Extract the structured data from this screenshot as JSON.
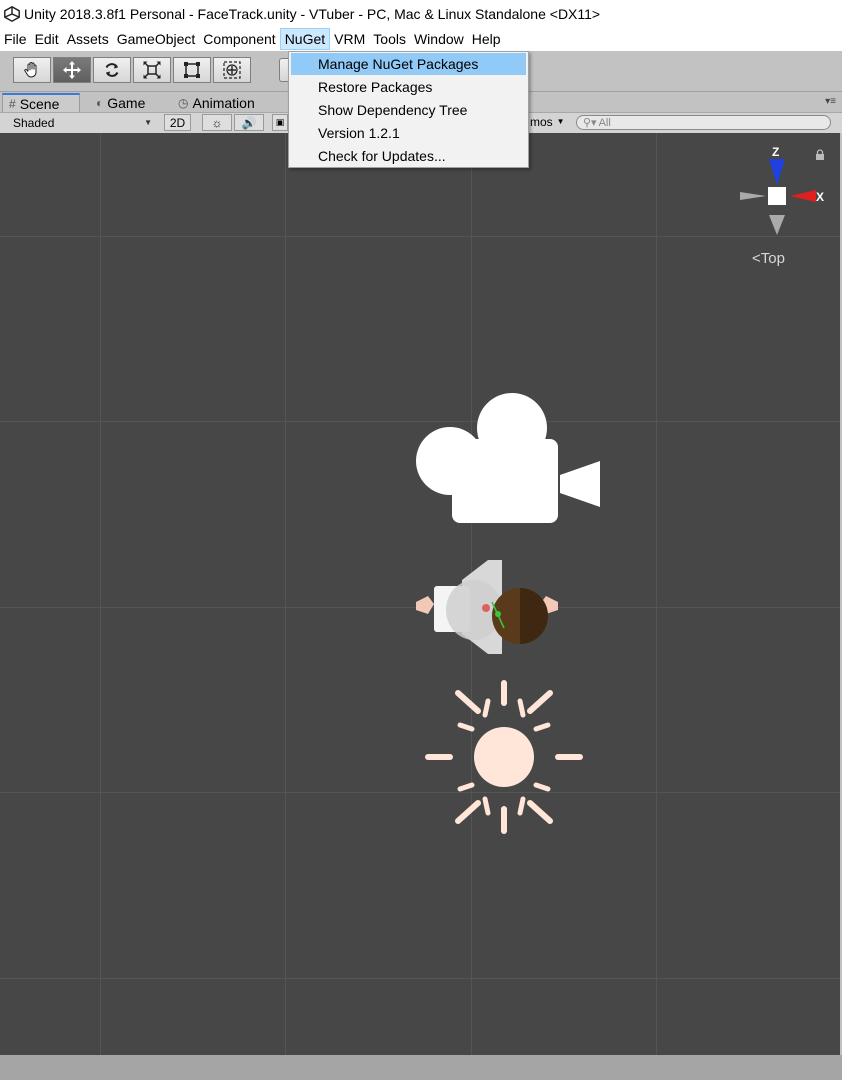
{
  "window": {
    "title": "Unity 2018.3.8f1 Personal - FaceTrack.unity - VTuber - PC, Mac & Linux Standalone <DX11>"
  },
  "menubar": {
    "items": [
      {
        "label": "File"
      },
      {
        "label": "Edit"
      },
      {
        "label": "Assets"
      },
      {
        "label": "GameObject"
      },
      {
        "label": "Component"
      },
      {
        "label": "NuGet"
      },
      {
        "label": "VRM"
      },
      {
        "label": "Tools"
      },
      {
        "label": "Window"
      },
      {
        "label": "Help"
      }
    ],
    "active": "NuGet"
  },
  "nuget_menu": {
    "items": [
      {
        "label": "Manage NuGet Packages",
        "highlighted": true
      },
      {
        "label": "Restore Packages"
      },
      {
        "label": "Show Dependency Tree"
      },
      {
        "label": "Version 1.2.1"
      },
      {
        "label": "Check for Updates..."
      }
    ]
  },
  "toolbar": {
    "tools": [
      "hand-tool-icon",
      "move-tool-icon",
      "rotate-tool-icon",
      "scale-tool-icon",
      "rect-tool-icon",
      "transform-tool-icon"
    ],
    "selected_tool": "move-tool-icon"
  },
  "tabs": [
    {
      "label": "Scene",
      "icon": "#",
      "active": true
    },
    {
      "label": "Game",
      "icon": "game-icon"
    },
    {
      "label": "Animation",
      "icon": "clock-icon"
    }
  ],
  "scene_toolbar": {
    "shading_mode": "Shaded",
    "mode_2d": "2D",
    "gizmos_label": "mos",
    "search_placeholder": "All"
  },
  "scene_view": {
    "orientation_label": "Top",
    "gizmo_axes": {
      "z": "Z",
      "x": "X"
    }
  },
  "colors": {
    "scene_bg": "#474747",
    "menu_highlight": "#91c9f7",
    "sun_color": "#ffe6d8",
    "axis_x": "#e02020",
    "axis_z": "#2040e0"
  }
}
